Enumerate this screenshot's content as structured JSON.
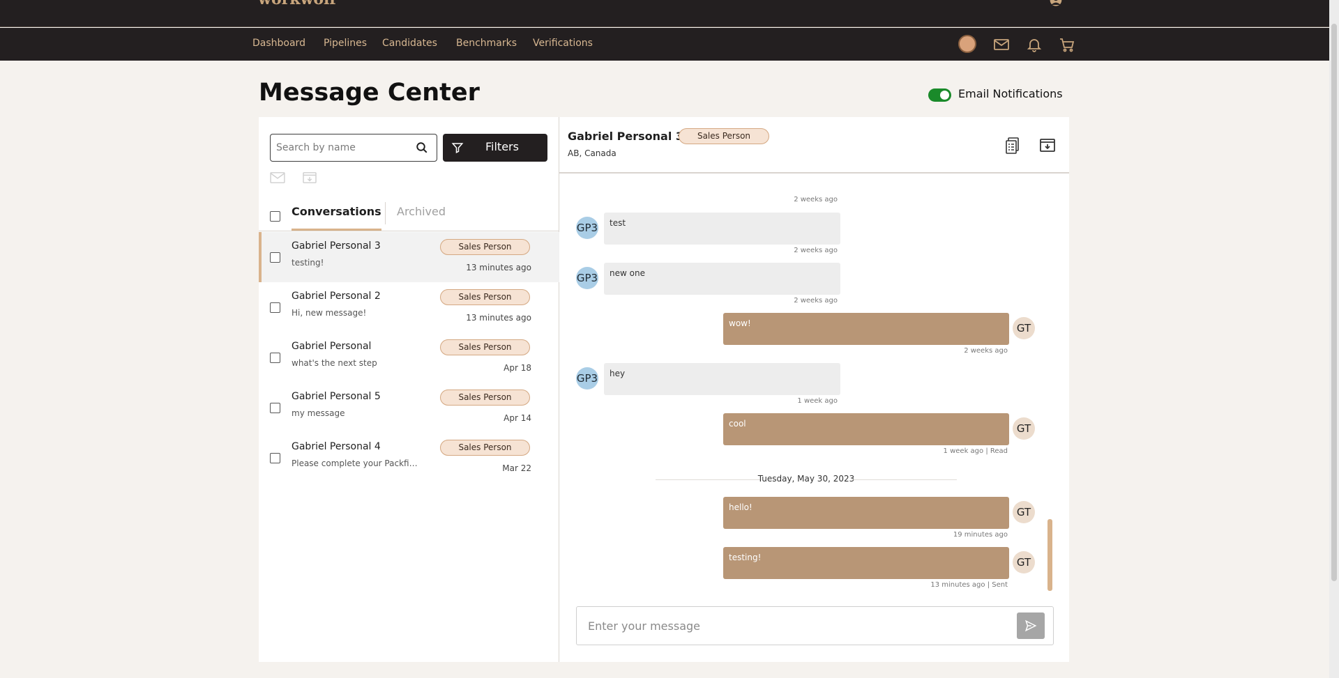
{
  "app": {
    "logo_text": "workwolf"
  },
  "nav": {
    "links": [
      "Dashboard",
      "Pipelines",
      "Candidates",
      "Benchmarks",
      "Verifications"
    ]
  },
  "page": {
    "title": "Message Center",
    "email_notifications_label": "Email Notifications",
    "email_notifications_on": true
  },
  "sidebar": {
    "search_placeholder": "Search by name",
    "filters_label": "Filters",
    "tabs": {
      "active": "Conversations",
      "inactive": "Archived"
    },
    "conversations": [
      {
        "name": "Gabriel Personal 3",
        "snippet": "testing!",
        "badge": "Sales Person",
        "time": "13 minutes ago",
        "selected": true
      },
      {
        "name": "Gabriel Personal 2",
        "snippet": "Hi, new message!",
        "badge": "Sales Person",
        "time": "13 minutes ago"
      },
      {
        "name": "Gabriel Personal",
        "snippet": "what's the next step",
        "badge": "Sales Person",
        "time": "Apr 18"
      },
      {
        "name": "Gabriel Personal 5",
        "snippet": "my message",
        "badge": "Sales Person",
        "time": "Apr 14"
      },
      {
        "name": "Gabriel Personal 4",
        "snippet": "Please complete your Packfin...",
        "badge": "Sales Person",
        "time": "Mar 22"
      }
    ]
  },
  "thread": {
    "contact_name": "Gabriel Personal 3",
    "contact_badge": "Sales Person",
    "contact_location": "AB, Canada",
    "top_partial_time": "2 weeks ago",
    "messages": [
      {
        "dir": "in",
        "avatar": "GP3",
        "text": "test",
        "time": "2 weeks ago"
      },
      {
        "dir": "in",
        "avatar": "GP3",
        "text": "new one",
        "time": "2 weeks ago"
      },
      {
        "dir": "out",
        "avatar": "GT",
        "text": "wow!",
        "time": "2 weeks ago"
      },
      {
        "dir": "in",
        "avatar": "GP3",
        "text": "hey",
        "time": "1 week ago"
      },
      {
        "dir": "out",
        "avatar": "GT",
        "text": "cool",
        "time": "1 week ago | Read"
      },
      {
        "dir": "out",
        "avatar": "GT",
        "text": "hello!",
        "time": "19 minutes ago"
      },
      {
        "dir": "out",
        "avatar": "GT",
        "text": "testing!",
        "time": "13 minutes ago | Sent"
      }
    ],
    "date_separator": "Tuesday, May 30, 2023",
    "composer_placeholder": "Enter your message"
  },
  "colors": {
    "bar_dark": "#231f20",
    "accent_tan": "#b89676",
    "badge_bg": "#f6e3d4",
    "toggle_green": "#1a8a2a"
  },
  "icons": [
    "user-icon",
    "coin-avatar",
    "mail-icon",
    "bell-icon",
    "cart-icon",
    "search-icon",
    "filter-icon",
    "archive-icon",
    "document-icon",
    "send-icon"
  ]
}
